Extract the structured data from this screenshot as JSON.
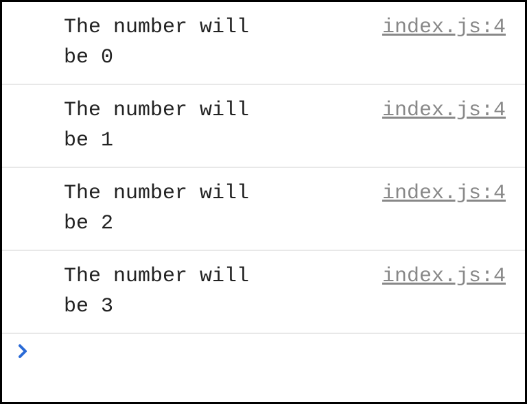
{
  "console": {
    "entries": [
      {
        "message": "The number will be 0",
        "source": "index.js:4"
      },
      {
        "message": "The number will be 1",
        "source": "index.js:4"
      },
      {
        "message": "The number will be 2",
        "source": "index.js:4"
      },
      {
        "message": "The number will be 3",
        "source": "index.js:4"
      }
    ],
    "prompt_glyph": "❯"
  }
}
